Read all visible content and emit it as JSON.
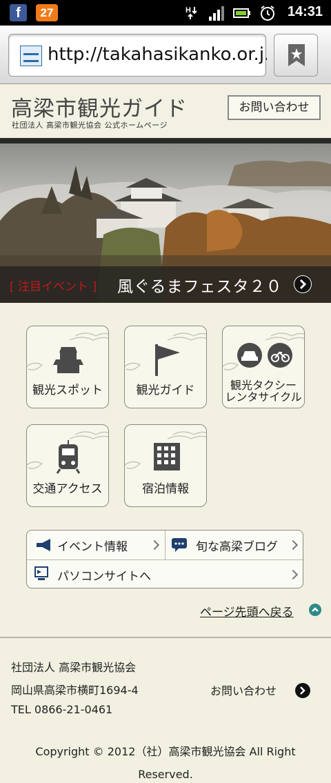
{
  "status_bar": {
    "badge_count": "27",
    "time": "14:31"
  },
  "browser": {
    "url": "http://takahasikanko.or.j..."
  },
  "header": {
    "title": "高梁市観光ガイド",
    "subtitle": "社団法人 高梁市観光協会 公式ホームページ",
    "contact_button": "お問い合わせ"
  },
  "hero": {
    "tag": "[ 注目イベント ]",
    "text": "風ぐるまフェスタ２０"
  },
  "tiles": {
    "spots": "観光スポット",
    "guide": "観光ガイド",
    "taxi_line1": "観光タクシー",
    "taxi_line2": "レンタサイクル",
    "access": "交通アクセス",
    "lodging": "宿泊情報"
  },
  "links": {
    "events": "イベント情報",
    "blog": "旬な高梁ブログ",
    "pc_site": "パソコンサイトへ"
  },
  "page_top": "ページ先頭へ戻る",
  "footer": {
    "org": "社団法人 高梁市観光協会",
    "address": "岡山県高梁市横町1694-4",
    "tel": "TEL 0866-21-0461",
    "contact": "お問い合わせ",
    "copyright_line1": "Copyright © 2012（社）高梁市観光協会 All Right",
    "copyright_line2": "Reserved."
  },
  "colors": {
    "page_bg": "#f2f0e1",
    "hero_tag": "#c0181a",
    "accent_teal": "#2e8a86"
  }
}
